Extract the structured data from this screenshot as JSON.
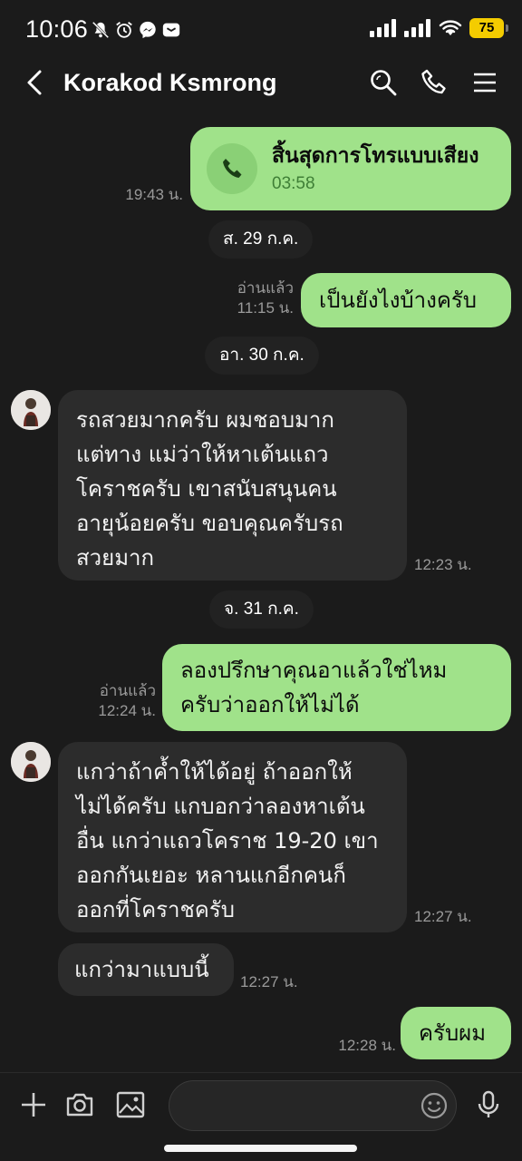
{
  "status_bar": {
    "time": "10:06",
    "battery": "75"
  },
  "header": {
    "title": "Korakod Ksmrong"
  },
  "call_card": {
    "title": "สิ้นสุดการโทรแบบเสียง",
    "duration": "03:58",
    "time": "19:43 น."
  },
  "dates": {
    "d1": "ส. 29 ก.ค.",
    "d2": "อา. 30 ก.ค.",
    "d3": "จ. 31 ก.ค."
  },
  "messages": {
    "m1": {
      "text": "เป็นยังไงบ้างครับ",
      "read": "อ่านแล้ว",
      "time": "11:15 น."
    },
    "m2": {
      "lines": [
        "รถสวยมากครับ ผมชอบมาก",
        "แต่ทาง แม่ว่าให้หาเต้นแถว",
        "โคราชครับ เขาสนับสนุนคน",
        "อายุน้อยครับ ขอบคุณครับรถ",
        "สวยมาก"
      ],
      "time": "12:23 น."
    },
    "m3": {
      "lines": [
        "ลองปรึกษาคุณอาแล้วใช่ไหม",
        "ครับว่าออกให้ไม่ได้"
      ],
      "read": "อ่านแล้ว",
      "time": "12:24 น."
    },
    "m4": {
      "lines": [
        "แกว่าถ้าค้ำให้ได้อยู่ ถ้าออกให้",
        "ไม่ได้ครับ แกบอกว่าลองหาเต้น",
        "อื่น แกว่าแถวโคราช 19-20 เขา",
        "ออกกันเยอะ หลานแกอีกคนก็",
        "ออกที่โคราชครับ"
      ],
      "time": "12:27 น."
    },
    "m5": {
      "text": "แกว่ามาแบบนี้",
      "time": "12:27 น."
    },
    "m6": {
      "text": "ครับผม",
      "time": "12:28 น."
    }
  },
  "icons": {
    "back": "chevron-left-icon",
    "search": "search-icon",
    "call": "phone-icon",
    "menu": "menu-icon",
    "add": "plus-icon",
    "camera": "camera-icon",
    "image": "image-icon",
    "emoji": "emoji-icon",
    "mic": "mic-icon"
  },
  "colors": {
    "outgoing_bubble": "#a0e28a",
    "incoming_bubble": "#2c2c2c",
    "background": "#1b1b1b"
  }
}
